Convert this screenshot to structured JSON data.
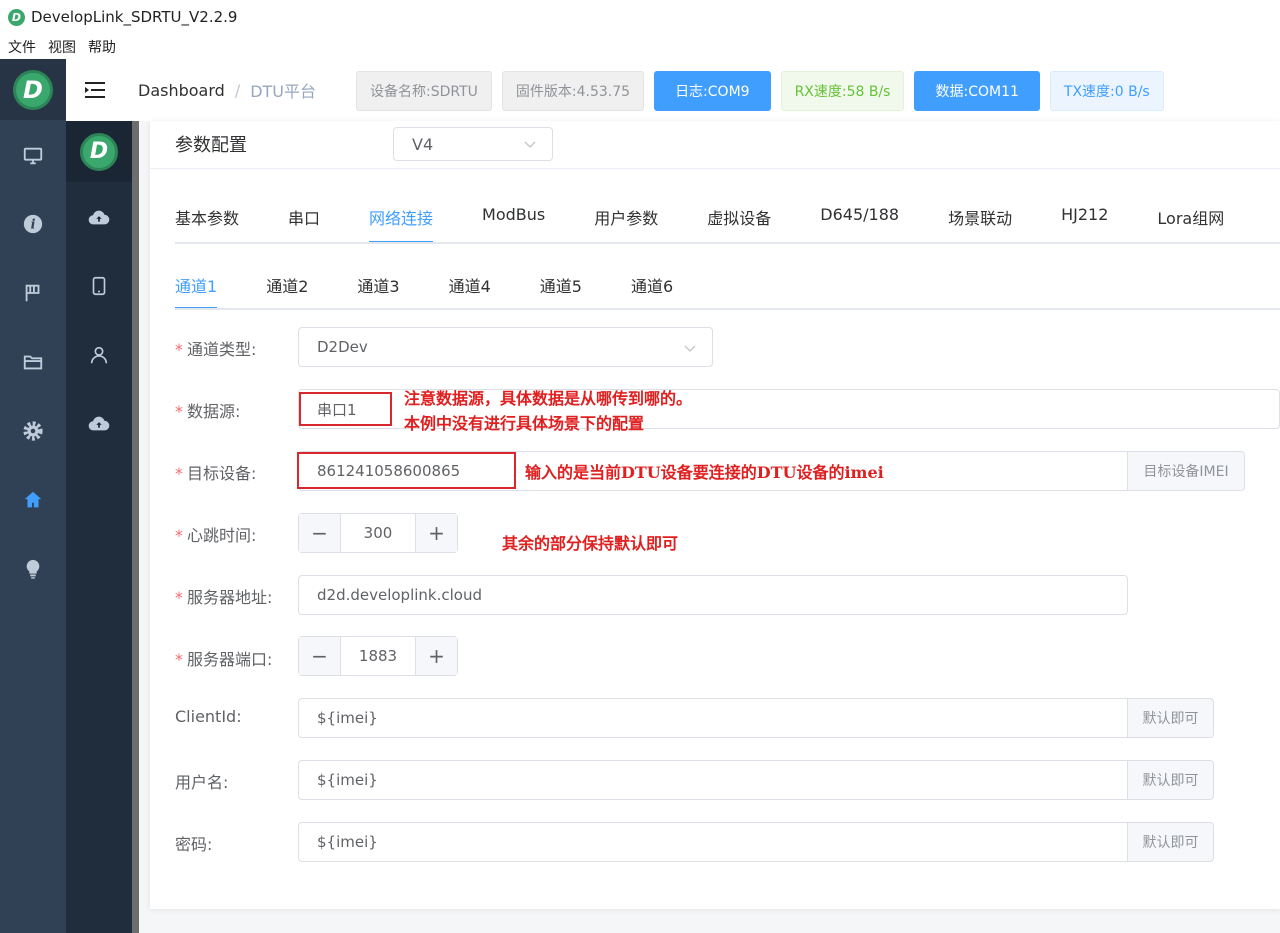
{
  "window": {
    "title": "DevelopLink_SDRTU_V2.2.9",
    "logo_letter": "D"
  },
  "menubar": [
    "文件",
    "视图",
    "帮助"
  ],
  "sidebar_primary": {
    "logo_letter": "D",
    "items": [
      "monitor-icon",
      "info-icon",
      "flag-icon",
      "folder-icon",
      "gear-icon",
      "home-icon",
      "bulb-icon"
    ],
    "active": "home-icon"
  },
  "sidebar_secondary": {
    "logo_letter": "D",
    "items": [
      "cloud-upload-icon",
      "mobile-icon",
      "user-icon",
      "cloud-upload-icon"
    ]
  },
  "header": {
    "breadcrumb": {
      "home": "Dashboard",
      "separator": "/",
      "current": "DTU平台"
    },
    "tags": {
      "device_name": "设备名称:SDRTU",
      "firmware": "固件版本:4.53.75",
      "log_port": "日志:COM9",
      "rx_speed": "RX速度:58 B/s",
      "data_port": "数据:COM11",
      "tx_speed": "TX速度:0 B/s"
    }
  },
  "config": {
    "title": "参数配置",
    "version": "V4"
  },
  "tabs_primary": {
    "items": [
      "基本参数",
      "串口",
      "网络连接",
      "ModBus",
      "用户参数",
      "虚拟设备",
      "D645/188",
      "场景联动",
      "HJ212",
      "Lora组网"
    ],
    "active": "网络连接"
  },
  "tabs_secondary": {
    "items": [
      "通道1",
      "通道2",
      "通道3",
      "通道4",
      "通道5",
      "通道6"
    ],
    "active": "通道1"
  },
  "form": {
    "channel_type": {
      "label": "通道类型:",
      "value": "D2Dev"
    },
    "data_source": {
      "label": "数据源:",
      "value": "串口1"
    },
    "target_device": {
      "label": "目标设备:",
      "value": "861241058600865",
      "append": "目标设备IMEI"
    },
    "heartbeat": {
      "label": "心跳时间:",
      "value": "300",
      "minus": "−",
      "plus": "+"
    },
    "server_address": {
      "label": "服务器地址:",
      "value": "d2d.developlink.cloud"
    },
    "server_port": {
      "label": "服务器端口:",
      "value": "1883",
      "minus": "−",
      "plus": "+"
    },
    "client_id": {
      "label": "ClientId:",
      "value": "${imei}",
      "append": "默认即可"
    },
    "username": {
      "label": "用户名:",
      "value": "${imei}",
      "append": "默认即可"
    },
    "password": {
      "label": "密码:",
      "value": "${imei}",
      "append": "默认即可"
    },
    "required_mark": "*"
  },
  "annotations": {
    "data_source_line1": "注意数据源，具体数据是从哪传到哪的。",
    "data_source_line2": "本例中没有进行具体场景下的配置",
    "target_device": "输入的是当前DTU设备要连接的DTU设备的imei",
    "rest": "其余的部分保持默认即可"
  },
  "colors": {
    "accent": "#409eff",
    "sidebar_primary": "#304156",
    "sidebar_secondary": "#1f2d3d",
    "logo_green": "#3aa76d",
    "annotation_red": "#e02020",
    "rx_green": "#67c23a"
  }
}
